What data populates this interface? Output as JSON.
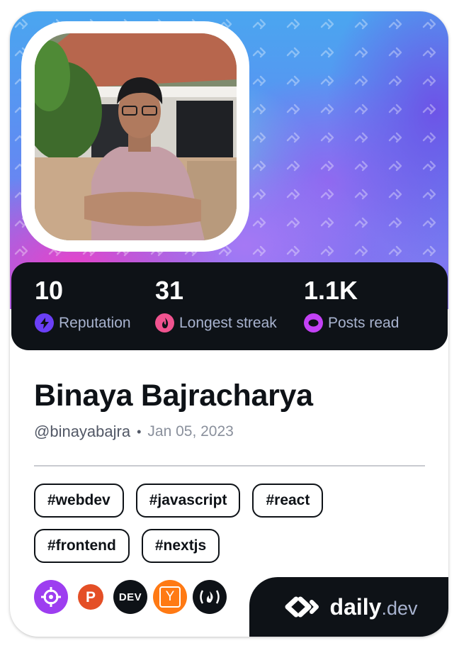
{
  "profile": {
    "name": "Binaya Bajracharya",
    "username": "@binayabajra",
    "separator": "•",
    "joined": "Jan 05, 2023",
    "avatar_alt": "Profile photo"
  },
  "stats": [
    {
      "value": "10",
      "label": "Reputation",
      "icon": "lightning-icon",
      "color": "#6b3ff7"
    },
    {
      "value": "31",
      "label": "Longest streak",
      "icon": "flame-icon",
      "color": "#f0538f"
    },
    {
      "value": "1.1K",
      "label": "Posts read",
      "icon": "eye-ring-icon",
      "color": "#c341f5"
    }
  ],
  "tags": [
    "#webdev",
    "#javascript",
    "#react",
    "#frontend",
    "#nextjs"
  ],
  "sources": [
    {
      "name": "crosshair-source-icon",
      "bg": "#9d3ef0",
      "glyph": ""
    },
    {
      "name": "product-hunt-icon",
      "bg": "#e44f26",
      "glyph": "P"
    },
    {
      "name": "dev-to-icon",
      "bg": "#0e1217",
      "glyph": "DEV"
    },
    {
      "name": "hacker-news-icon",
      "bg": "#ff7a14",
      "glyph": "Y"
    },
    {
      "name": "freecodecamp-icon",
      "bg": "#0e1217",
      "glyph": "(🔥)"
    }
  ],
  "brand": {
    "daily": "daily",
    "dev": ".dev"
  },
  "colors": {
    "card_bg": "#ffffff",
    "dark": "#0e1217",
    "muted": "#a8b3cf"
  }
}
